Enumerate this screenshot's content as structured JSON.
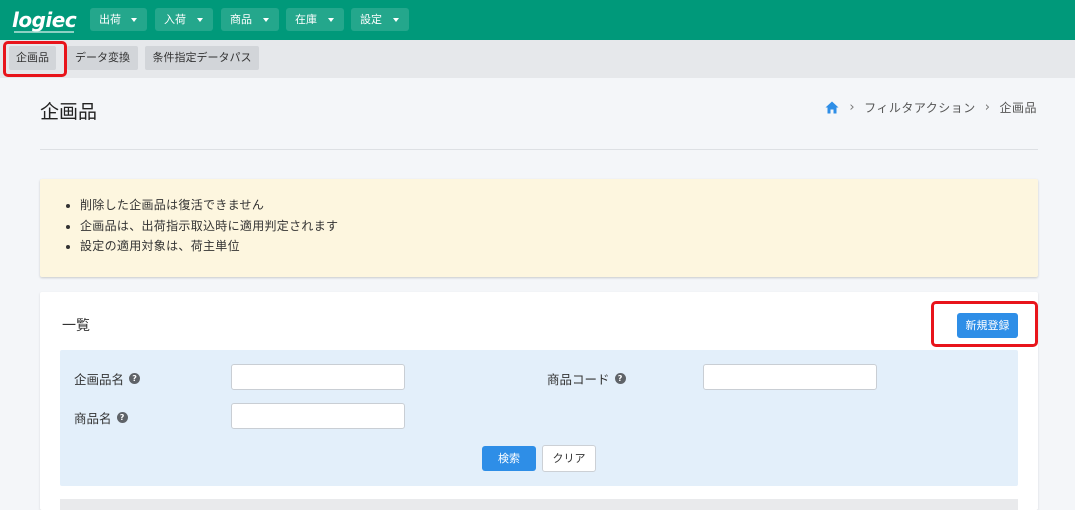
{
  "header": {
    "logo_text": "logiec",
    "menus": [
      {
        "label": "出荷"
      },
      {
        "label": "入荷"
      },
      {
        "label": "商品"
      },
      {
        "label": "在庫"
      },
      {
        "label": "設定"
      }
    ]
  },
  "subnav": {
    "tabs": [
      {
        "label": "企画品"
      },
      {
        "label": "データ変換"
      },
      {
        "label": "条件指定データパス"
      }
    ]
  },
  "page": {
    "title": "企画品",
    "breadcrumb": [
      "フィルタアクション",
      "企画品"
    ]
  },
  "notice": {
    "items": [
      "削除した企画品は復活できません",
      "企画品は、出荷指示取込時に適用判定されます",
      "設定の適用対象は、荷主単位"
    ]
  },
  "list_card": {
    "title": "一覧",
    "new_button_label": "新規登録",
    "filters": {
      "plan_item_name_label": "企画品名",
      "product_code_label": "商品コード",
      "product_name_label": "商品名",
      "plan_item_name_value": "",
      "product_code_value": "",
      "product_name_value": ""
    },
    "search_button_label": "検索",
    "clear_button_label": "クリア"
  },
  "colors": {
    "header_bg": "#00997a",
    "primary_button": "#2e8ee7",
    "notice_bg": "#fdf6df",
    "filter_bg": "#e3effa",
    "highlight": "#e8141b"
  }
}
